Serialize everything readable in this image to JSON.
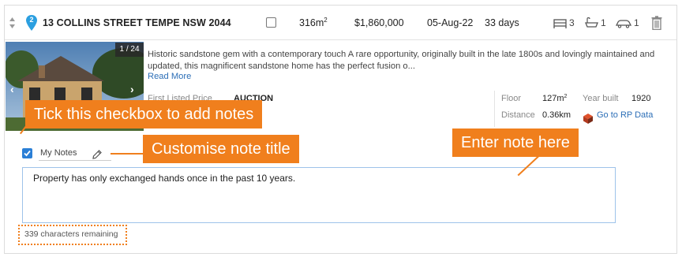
{
  "listing": {
    "pin_number": "2",
    "address": "13 COLLINS STREET TEMPE NSW 2044",
    "area_value": "316m",
    "area_sup": "2",
    "price": "$1,860,000",
    "sold_date": "05-Aug-22",
    "days_on_market": "33 days",
    "beds": "3",
    "baths": "1",
    "cars": "1",
    "photo_count": "1 / 24",
    "description": "Historic sandstone gem with a contemporary touch A rare opportunity, originally built in the late 1800s and lovingly maintained and updated, this magnificent sandstone home has the perfect fusion o...",
    "read_more": "Read More",
    "first_listed_label": "First Listed Price",
    "first_listed_value": "AUCTION",
    "stats": {
      "floor_label": "Floor",
      "floor_value": "127m",
      "floor_sup": "2",
      "year_label": "Year built",
      "year_value": "1920",
      "distance_label": "Distance",
      "distance_value": "0.36km",
      "rp_link": "Go to RP Data"
    }
  },
  "notes": {
    "title": "My Notes",
    "content": "Property has only exchanged hands once in the past 10 years.",
    "chars_remaining": "339 characters remaining"
  },
  "callouts": {
    "checkbox": "Tick this checkbox to add notes",
    "title": "Customise note title",
    "note": "Enter note here"
  },
  "colors": {
    "accent": "#f07f1d",
    "link": "#2d6fb7",
    "pin": "#2b9fe0",
    "checkbox": "#2b7fd6"
  }
}
